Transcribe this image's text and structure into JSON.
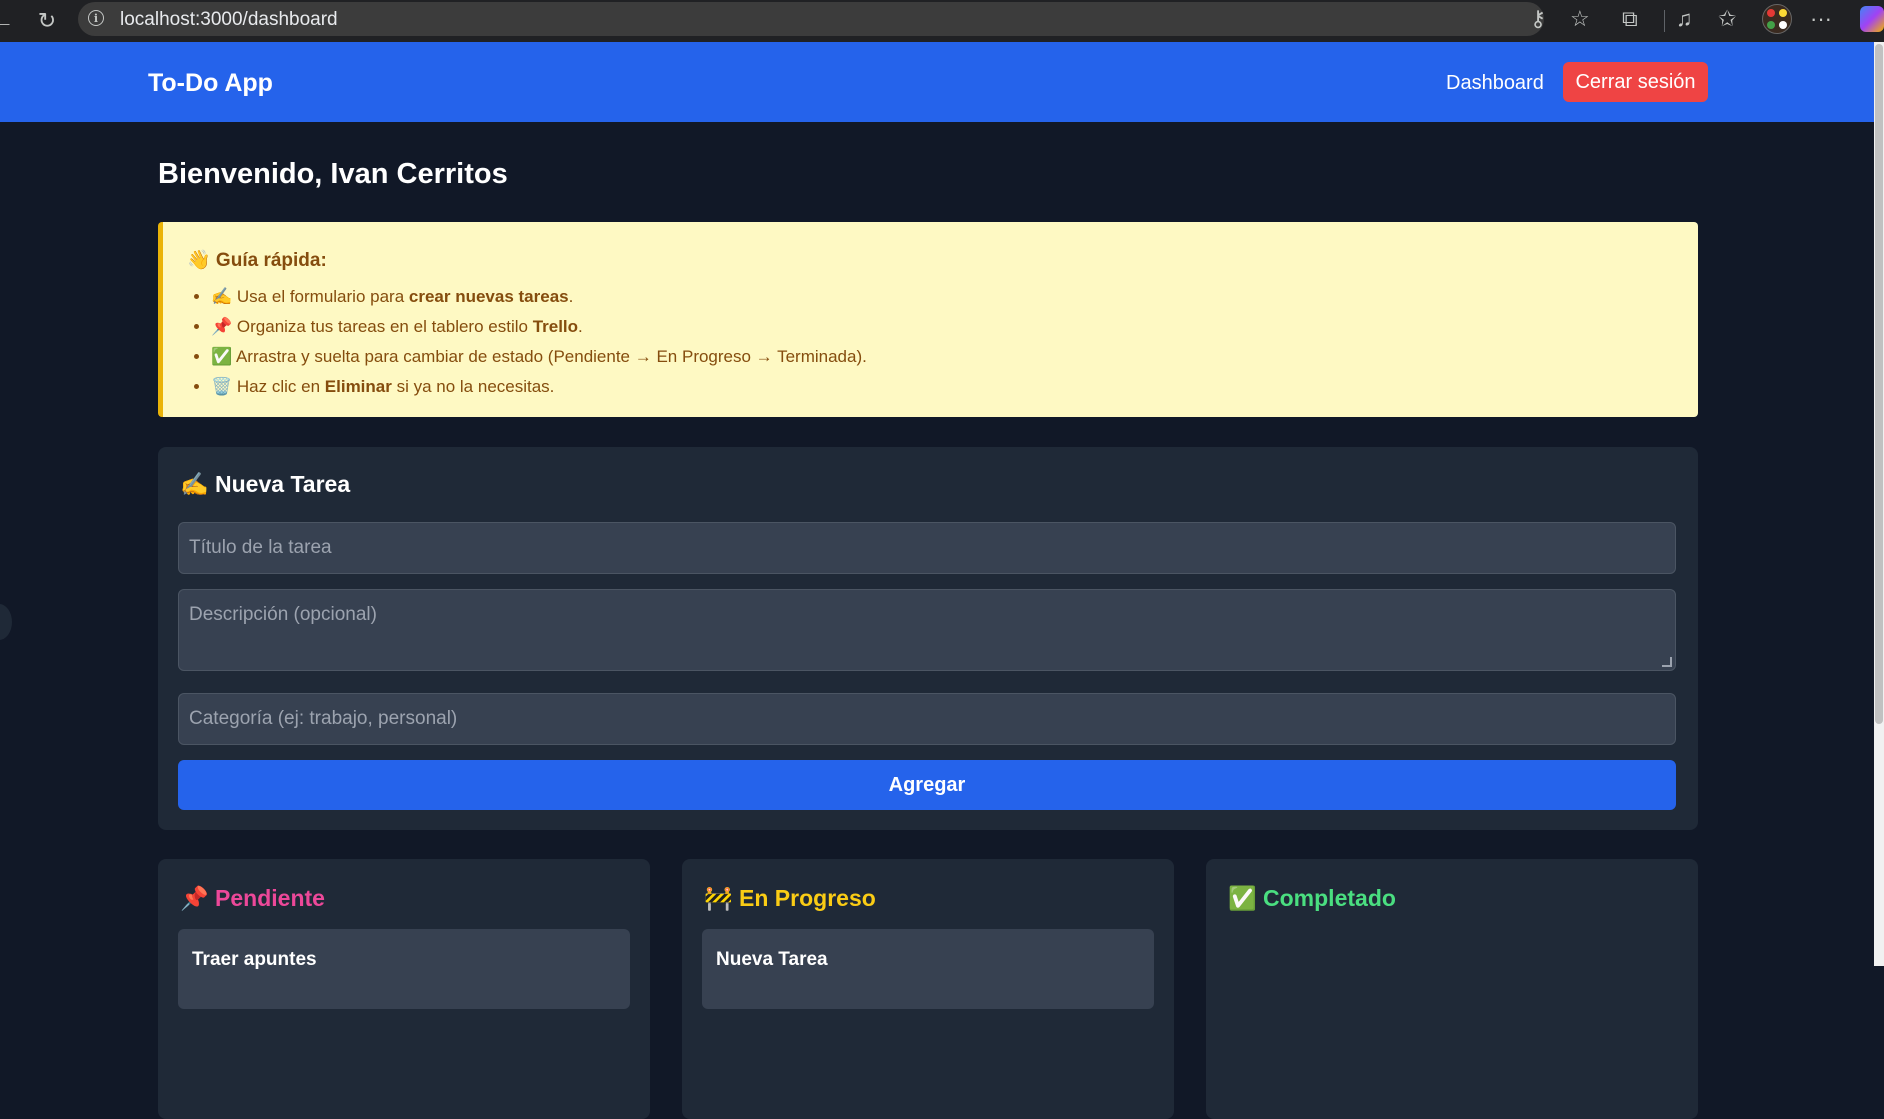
{
  "browser": {
    "url": "localhost:3000/dashboard",
    "icons": [
      "back-arrow-icon",
      "reload-icon",
      "info-icon",
      "key-icon",
      "star-icon",
      "extensions-icon",
      "media-icon",
      "favorites-icon",
      "profile-avatar",
      "more-icon"
    ]
  },
  "navbar": {
    "brand": "To-Do App",
    "dashboard_link": "Dashboard",
    "logout_label": "Cerrar sesión",
    "colors": {
      "background": "#2563eb",
      "logout": "#ef4444"
    }
  },
  "welcome": "Bienvenido, Ivan Cerritos",
  "guide": {
    "title": "👋 Guía rápida:",
    "items": [
      {
        "icon": "✍️",
        "pre": "Usa el formulario para ",
        "bold": "crear nuevas tareas",
        "post": "."
      },
      {
        "icon": "📌",
        "pre": "Organiza tus tareas en el tablero estilo ",
        "bold": "Trello",
        "post": "."
      },
      {
        "icon": "✅",
        "pre": "Arrastra y suelta para cambiar de estado (Pendiente → En Progreso → Terminada).",
        "bold": "",
        "post": ""
      },
      {
        "icon": "🗑️",
        "pre": "Haz clic en ",
        "bold": "Eliminar",
        "post": " si ya no la necesitas."
      }
    ]
  },
  "form": {
    "title": "✍️ Nueva Tarea",
    "title_placeholder": "Título de la tarea",
    "description_placeholder": "Descripción (opcional)",
    "category_placeholder": "Categoría (ej: trabajo, personal)",
    "submit_label": "Agregar"
  },
  "board": {
    "columns": [
      {
        "title": "📌 Pendiente",
        "color": "#ec4899",
        "cards": [
          "Traer apuntes"
        ]
      },
      {
        "title": "🚧 En Progreso",
        "color": "#facc15",
        "cards": [
          "Nueva Tarea"
        ]
      },
      {
        "title": "✅ Completado",
        "color": "#4ade80",
        "cards": []
      }
    ]
  }
}
